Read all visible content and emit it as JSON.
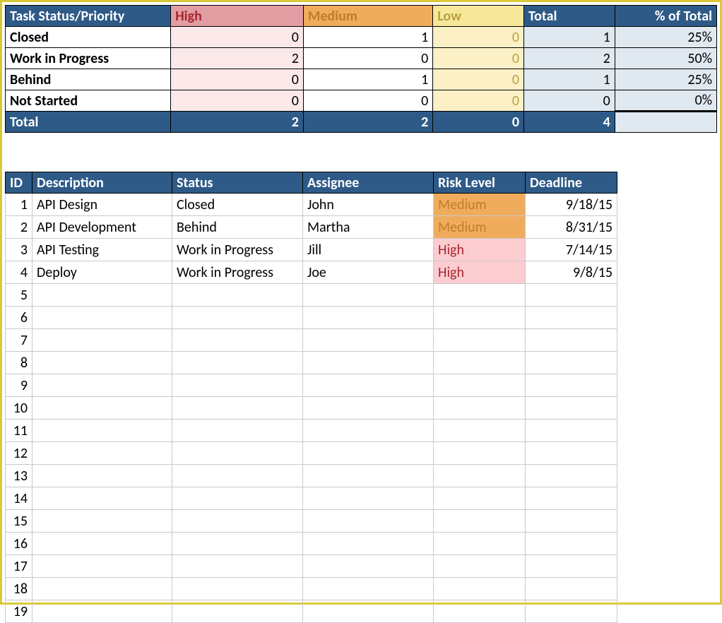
{
  "summary": {
    "headers": {
      "tsp": "Task Status/Priority",
      "high": "High",
      "medium": "Medium",
      "low": "Low",
      "total": "Total",
      "pct": "% of Total"
    },
    "rows": [
      {
        "label": "Closed",
        "high": "0",
        "medium": "1",
        "low": "0",
        "total": "1",
        "pct": "25%"
      },
      {
        "label": "Work in Progress",
        "high": "2",
        "medium": "0",
        "low": "0",
        "total": "2",
        "pct": "50%"
      },
      {
        "label": "Behind",
        "high": "0",
        "medium": "1",
        "low": "0",
        "total": "1",
        "pct": "25%"
      },
      {
        "label": "Not Started",
        "high": "0",
        "medium": "0",
        "low": "0",
        "total": "0",
        "pct": "0%"
      }
    ],
    "footer": {
      "label": "Total",
      "high": "2",
      "medium": "2",
      "low": "0",
      "total": "4",
      "pct": ""
    }
  },
  "tasks": {
    "headers": {
      "id": "ID",
      "desc": "Description",
      "status": "Status",
      "assignee": "Assignee",
      "risk": "Risk Level",
      "deadline": "Deadline"
    },
    "rows": [
      {
        "id": "1",
        "desc": "API Design",
        "status": "Closed",
        "assignee": "John",
        "risk": "Medium",
        "deadline": "9/18/15"
      },
      {
        "id": "2",
        "desc": "API Development",
        "status": "Behind",
        "assignee": "Martha",
        "risk": "Medium",
        "deadline": "8/31/15"
      },
      {
        "id": "3",
        "desc": "API Testing",
        "status": "Work in Progress",
        "assignee": "Jill",
        "risk": "High",
        "deadline": "7/14/15"
      },
      {
        "id": "4",
        "desc": "Deploy",
        "status": "Work in Progress",
        "assignee": "Joe",
        "risk": "High",
        "deadline": "9/8/15"
      },
      {
        "id": "5",
        "desc": "",
        "status": "",
        "assignee": "",
        "risk": "",
        "deadline": ""
      },
      {
        "id": "6",
        "desc": "",
        "status": "",
        "assignee": "",
        "risk": "",
        "deadline": ""
      },
      {
        "id": "7",
        "desc": "",
        "status": "",
        "assignee": "",
        "risk": "",
        "deadline": ""
      },
      {
        "id": "8",
        "desc": "",
        "status": "",
        "assignee": "",
        "risk": "",
        "deadline": ""
      },
      {
        "id": "9",
        "desc": "",
        "status": "",
        "assignee": "",
        "risk": "",
        "deadline": ""
      },
      {
        "id": "10",
        "desc": "",
        "status": "",
        "assignee": "",
        "risk": "",
        "deadline": ""
      },
      {
        "id": "11",
        "desc": "",
        "status": "",
        "assignee": "",
        "risk": "",
        "deadline": ""
      },
      {
        "id": "12",
        "desc": "",
        "status": "",
        "assignee": "",
        "risk": "",
        "deadline": ""
      },
      {
        "id": "13",
        "desc": "",
        "status": "",
        "assignee": "",
        "risk": "",
        "deadline": ""
      },
      {
        "id": "14",
        "desc": "",
        "status": "",
        "assignee": "",
        "risk": "",
        "deadline": ""
      },
      {
        "id": "15",
        "desc": "",
        "status": "",
        "assignee": "",
        "risk": "",
        "deadline": ""
      },
      {
        "id": "16",
        "desc": "",
        "status": "",
        "assignee": "",
        "risk": "",
        "deadline": ""
      },
      {
        "id": "17",
        "desc": "",
        "status": "",
        "assignee": "",
        "risk": "",
        "deadline": ""
      },
      {
        "id": "18",
        "desc": "",
        "status": "",
        "assignee": "",
        "risk": "",
        "deadline": ""
      },
      {
        "id": "19",
        "desc": "",
        "status": "",
        "assignee": "",
        "risk": "",
        "deadline": ""
      }
    ]
  },
  "chart_data": {
    "type": "table",
    "title": "Task Status/Priority",
    "categories": [
      "Closed",
      "Work in Progress",
      "Behind",
      "Not Started"
    ],
    "series": [
      {
        "name": "High",
        "values": [
          0,
          2,
          0,
          0
        ]
      },
      {
        "name": "Medium",
        "values": [
          1,
          0,
          1,
          0
        ]
      },
      {
        "name": "Low",
        "values": [
          0,
          0,
          0,
          0
        ]
      }
    ],
    "totals_per_row": [
      1,
      2,
      1,
      0
    ],
    "pct_of_total": [
      25,
      50,
      25,
      0
    ],
    "column_totals": {
      "High": 2,
      "Medium": 2,
      "Low": 0,
      "Total": 4
    }
  }
}
